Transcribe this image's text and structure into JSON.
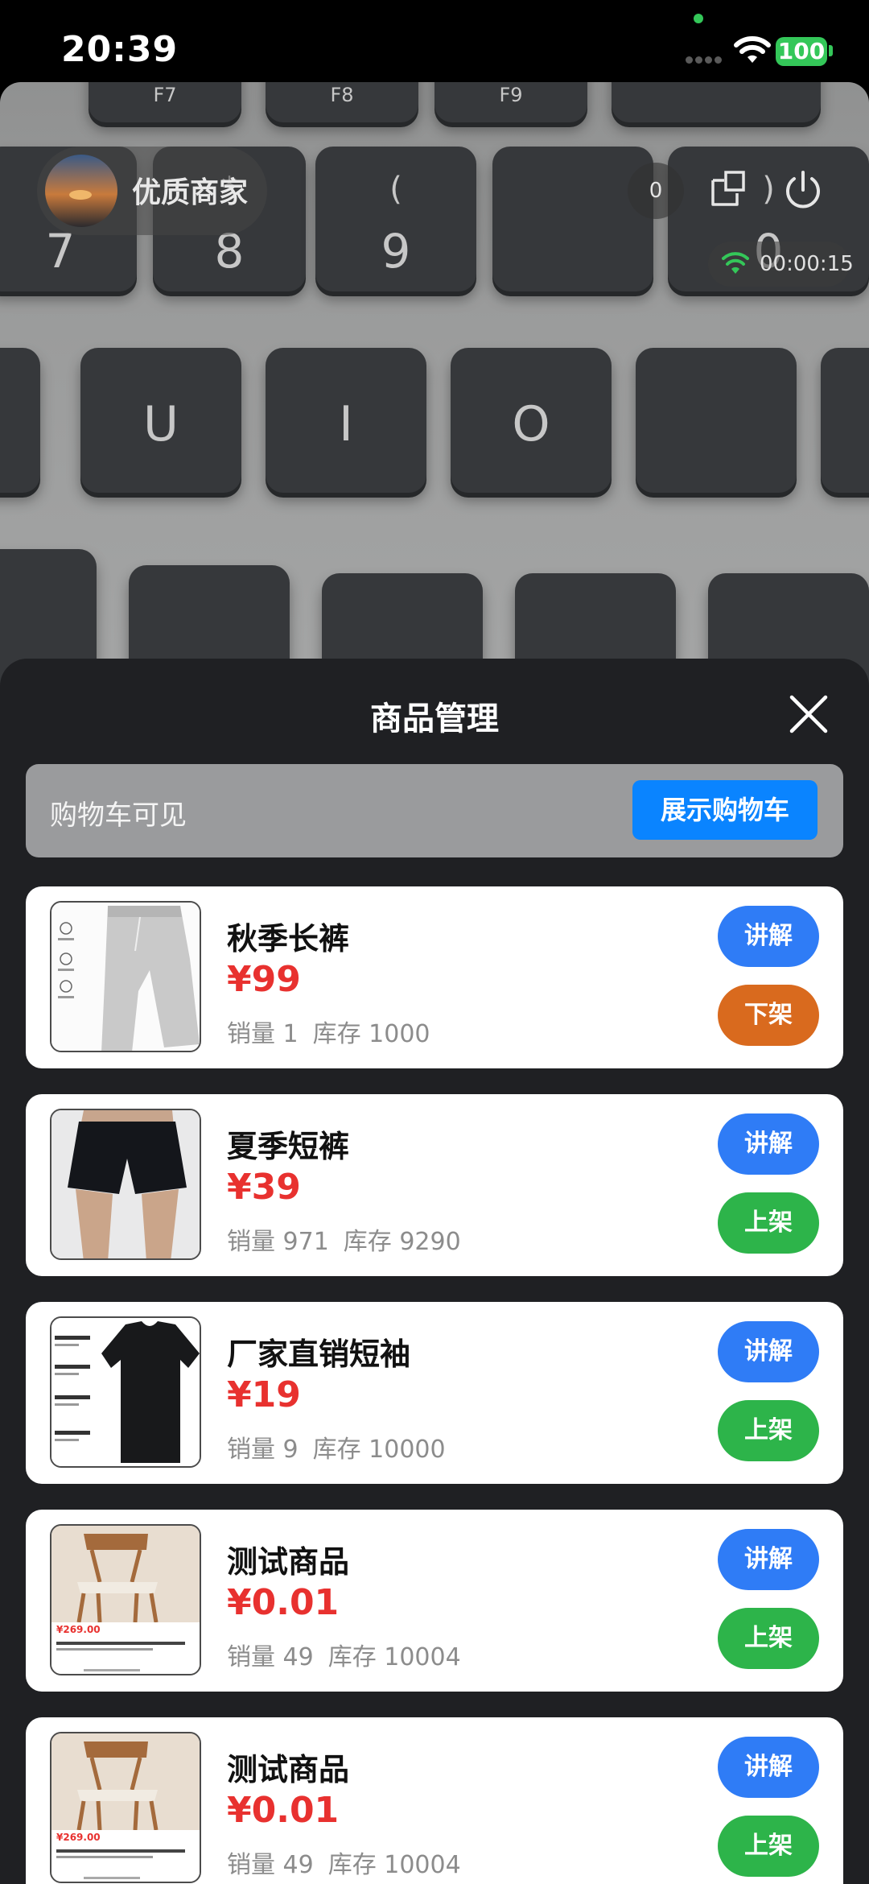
{
  "status_bar": {
    "time": "20:39",
    "battery": "100"
  },
  "live": {
    "host_name": "优质商家",
    "viewer_count": "0",
    "timer": "00:00:15",
    "keyboard_keys": {
      "f7": "F7",
      "f8": "F8",
      "f9": "F9",
      "k7_top": "&",
      "k7": "7",
      "k8_top": "*",
      "k8": "8",
      "k9_top": "(",
      "k9": "9",
      "k0_top": ")",
      "k0": "0",
      "u": "U",
      "i": "I",
      "o": "O"
    }
  },
  "sheet": {
    "title": "商品管理",
    "cart_label": "购物车可见",
    "cart_button": "展示购物车",
    "explain_label": "讲解",
    "products": [
      {
        "name": "秋季长裤",
        "price": "¥99",
        "sales": "销量 1",
        "stock": "库存 1000",
        "shelf_label": "下架",
        "shelf_state": "off"
      },
      {
        "name": "夏季短裤",
        "price": "¥39",
        "sales": "销量 971",
        "stock": "库存 9290",
        "shelf_label": "上架",
        "shelf_state": "on"
      },
      {
        "name": "厂家直销短袖",
        "price": "¥19",
        "sales": "销量 9",
        "stock": "库存 10000",
        "shelf_label": "上架",
        "shelf_state": "on"
      },
      {
        "name": "测试商品",
        "price": "¥0.01",
        "sales": "销量 49",
        "stock": "库存 10004",
        "shelf_label": "上架",
        "shelf_state": "on"
      },
      {
        "name": "测试商品",
        "price": "¥0.01",
        "sales": "销量 49",
        "stock": "库存 10004",
        "shelf_label": "上架",
        "shelf_state": "on"
      }
    ],
    "thumb_text": {
      "chair_price": "¥269.00",
      "chair_price2": "¥269.00"
    }
  },
  "colors": {
    "price": "#e8312f",
    "explain_button": "#2f7cf6",
    "shelf_on": "#2db44a",
    "shelf_off": "#d96a1e",
    "cart_button": "#0a84ff"
  },
  "icons": [
    "wifi-icon",
    "battery-icon",
    "share-icon",
    "power-icon",
    "close-icon",
    "signal-icon"
  ]
}
